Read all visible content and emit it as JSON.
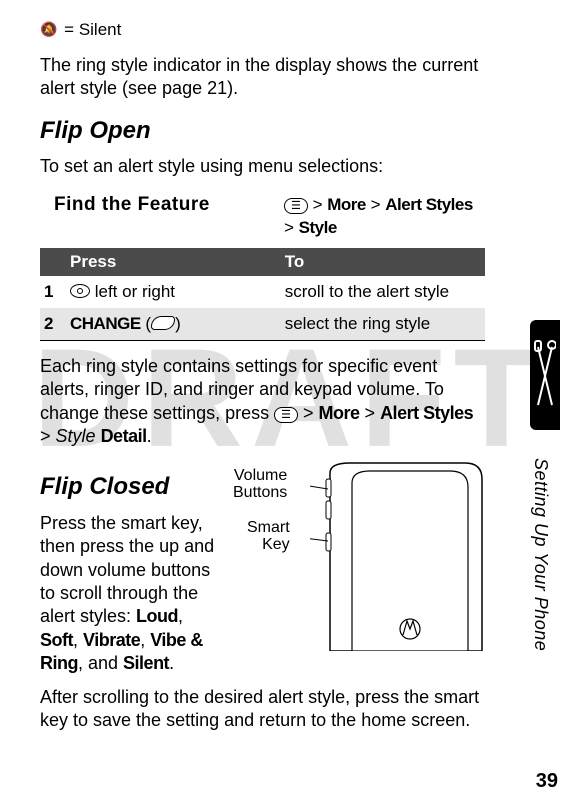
{
  "silent": {
    "glyph": "🔕",
    "eq": " = ",
    "label": "Silent"
  },
  "intro": "The ring style indicator in the display shows the current alert style (see page 21).",
  "flip_open": {
    "heading": "Flip Open",
    "lede": "To set an alert style using menu selections:",
    "feature_label": "Find the Feature",
    "menu_glyph": "☰",
    "gt": " > ",
    "more": "More",
    "alert_styles": "Alert Styles",
    "style": "Style"
  },
  "table": {
    "press_h": "Press",
    "to_h": "To",
    "rows": [
      {
        "n": "1",
        "press_text": " left or right",
        "to": "scroll to the alert style"
      },
      {
        "n": "2",
        "press_label": "CHANGE",
        "press_suffix": " (",
        "press_close": ")",
        "to": "select the ring style"
      }
    ]
  },
  "after_table": {
    "t1": "Each ring style contains settings for specific event alerts, ringer ID, and ringer and keypad volume. To change these settings, press ",
    "menu_glyph": "☰",
    "more": "More",
    "alert_styles": "Alert Styles",
    "style_italic": "Style",
    "detail": "Detail",
    "period": "."
  },
  "flip_closed": {
    "heading": "Flip Closed",
    "p1a": "Press the smart key, then press the up and down volume buttons to scroll through the alert styles: ",
    "loud": "Loud",
    "soft": "Soft",
    "vibrate": "Vibrate",
    "vibe_ring": "Vibe & Ring",
    "and": ", and ",
    "silent": "Silent",
    "comma": ", ",
    "period": ".",
    "p2": "After scrolling to the desired alert style, press the smart key to save the setting and return to the home screen.",
    "label_volume_l1": "Volume",
    "label_volume_l2": "Buttons",
    "label_smart_l1": "Smart",
    "label_smart_l2": "Key"
  },
  "side_text": "Setting Up Your Phone",
  "page_number": "39",
  "draft": "DRAFT"
}
